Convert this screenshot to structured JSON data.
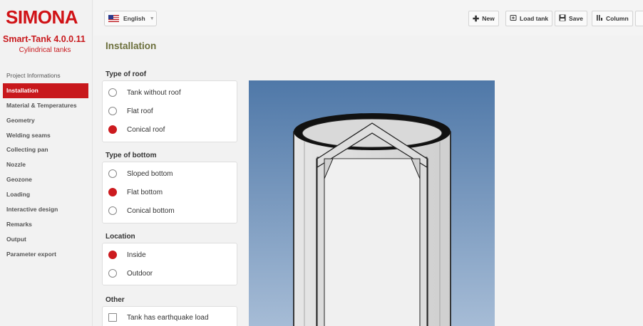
{
  "brand": {
    "logo": "SIMONA",
    "app_title": "Smart-Tank 4.0.0.11",
    "app_subtitle": "Cylindrical tanks"
  },
  "sidebar": {
    "items": [
      {
        "label": "Project Informations",
        "active": false
      },
      {
        "label": "Installation",
        "active": true
      },
      {
        "label": "Material & Temperatures",
        "active": false
      },
      {
        "label": "Geometry",
        "active": false
      },
      {
        "label": "Welding seams",
        "active": false
      },
      {
        "label": "Collecting pan",
        "active": false
      },
      {
        "label": "Nozzle",
        "active": false
      },
      {
        "label": "Geozone",
        "active": false
      },
      {
        "label": "Loading",
        "active": false
      },
      {
        "label": "Interactive design",
        "active": false
      },
      {
        "label": "Remarks",
        "active": false
      },
      {
        "label": "Output",
        "active": false
      },
      {
        "label": "Parameter export",
        "active": false
      }
    ]
  },
  "topbar": {
    "language": "English",
    "buttons": {
      "new": "New",
      "load": "Load tank",
      "save": "Save",
      "column": "Column"
    }
  },
  "page": {
    "title": "Installation"
  },
  "roof": {
    "title": "Type of roof",
    "options": [
      "Tank without roof",
      "Flat roof",
      "Conical roof"
    ],
    "selected": "Conical roof"
  },
  "bottom": {
    "title": "Type of bottom",
    "options": [
      "Sloped bottom",
      "Flat bottom",
      "Conical bottom"
    ],
    "selected": "Flat bottom"
  },
  "location": {
    "title": "Location",
    "options": [
      "Inside",
      "Outdoor"
    ],
    "selected": "Inside"
  },
  "other": {
    "title": "Other",
    "checkbox_label": "Tank has earthquake load",
    "checked": false
  },
  "colors": {
    "accent": "#c8181c",
    "title_olive": "#6b6f3b",
    "sky_top": "#4f78a8",
    "sky_bottom": "#a6bcd6"
  },
  "icons": {
    "new": "plus-icon",
    "load": "folder-icon",
    "save": "floppy-icon",
    "column": "column-icon"
  }
}
